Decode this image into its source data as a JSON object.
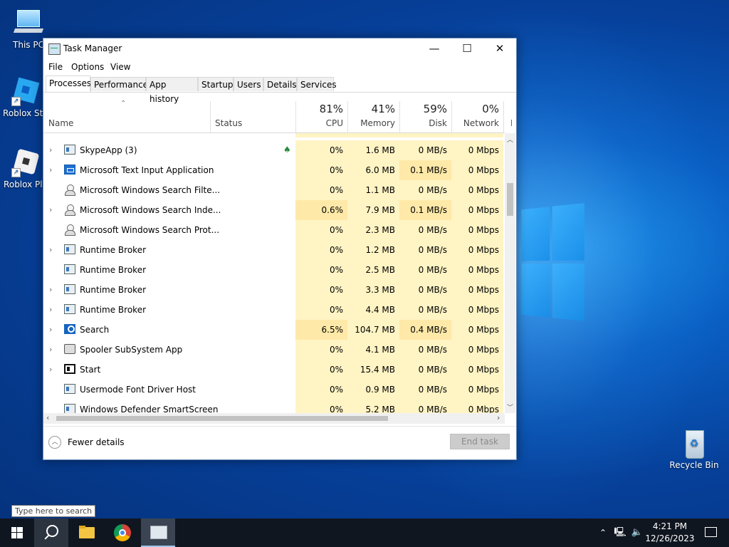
{
  "desktop": {
    "icons": [
      {
        "label": "This PC"
      },
      {
        "label": "Roblox Stu"
      },
      {
        "label": "Roblox Pla"
      },
      {
        "label": "Recycle Bin"
      }
    ]
  },
  "window": {
    "title": "Task Manager",
    "controls": {
      "minimize": "—",
      "maximize": "☐",
      "close": "✕"
    },
    "menu": [
      "File",
      "Options",
      "View"
    ],
    "tabs": [
      "Processes",
      "Performance",
      "App history",
      "Startup",
      "Users",
      "Details",
      "Services"
    ],
    "active_tab": "Processes",
    "columns": {
      "name": "Name",
      "status": "Status",
      "cpu": {
        "percent": "81%",
        "label": "CPU"
      },
      "memory": {
        "percent": "41%",
        "label": "Memory"
      },
      "disk": {
        "percent": "59%",
        "label": "Disk"
      },
      "network": {
        "percent": "0%",
        "label": "Network"
      },
      "power": {
        "label": "P"
      }
    },
    "processes": [
      {
        "name": "SkypeApp (3)",
        "expandable": true,
        "icon": "window-icon",
        "status_icon": "leaf-icon",
        "cpu": "0%",
        "memory": "1.6 MB",
        "disk": "0 MB/s",
        "network": "0 Mbps"
      },
      {
        "name": "Microsoft Text Input Application",
        "expandable": true,
        "icon": "keyboard-icon",
        "cpu": "0%",
        "memory": "6.0 MB",
        "disk": "0.1 MB/s",
        "network": "0 Mbps"
      },
      {
        "name": "Microsoft Windows Search Filte...",
        "expandable": false,
        "icon": "search-user-icon",
        "cpu": "0%",
        "memory": "1.1 MB",
        "disk": "0 MB/s",
        "network": "0 Mbps"
      },
      {
        "name": "Microsoft Windows Search Inde...",
        "expandable": true,
        "icon": "search-user-icon",
        "cpu": "0.6%",
        "memory": "7.9 MB",
        "disk": "0.1 MB/s",
        "network": "0 Mbps"
      },
      {
        "name": "Microsoft Windows Search Prot...",
        "expandable": false,
        "icon": "search-user-icon",
        "cpu": "0%",
        "memory": "2.3 MB",
        "disk": "0 MB/s",
        "network": "0 Mbps"
      },
      {
        "name": "Runtime Broker",
        "expandable": true,
        "icon": "window-icon",
        "cpu": "0%",
        "memory": "1.2 MB",
        "disk": "0 MB/s",
        "network": "0 Mbps"
      },
      {
        "name": "Runtime Broker",
        "expandable": false,
        "icon": "window-icon",
        "cpu": "0%",
        "memory": "2.5 MB",
        "disk": "0 MB/s",
        "network": "0 Mbps"
      },
      {
        "name": "Runtime Broker",
        "expandable": true,
        "icon": "window-icon",
        "cpu": "0%",
        "memory": "3.3 MB",
        "disk": "0 MB/s",
        "network": "0 Mbps"
      },
      {
        "name": "Runtime Broker",
        "expandable": true,
        "icon": "window-icon",
        "cpu": "0%",
        "memory": "4.4 MB",
        "disk": "0 MB/s",
        "network": "0 Mbps"
      },
      {
        "name": "Search",
        "expandable": true,
        "icon": "search-icon",
        "cpu": "6.5%",
        "memory": "104.7 MB",
        "disk": "0.4 MB/s",
        "network": "0 Mbps"
      },
      {
        "name": "Spooler SubSystem App",
        "expandable": true,
        "icon": "printer-icon",
        "cpu": "0%",
        "memory": "4.1 MB",
        "disk": "0 MB/s",
        "network": "0 Mbps"
      },
      {
        "name": "Start",
        "expandable": true,
        "icon": "start-icon",
        "cpu": "0%",
        "memory": "15.4 MB",
        "disk": "0 MB/s",
        "network": "0 Mbps"
      },
      {
        "name": "Usermode Font Driver Host",
        "expandable": false,
        "icon": "window-icon",
        "cpu": "0%",
        "memory": "0.9 MB",
        "disk": "0 MB/s",
        "network": "0 Mbps"
      },
      {
        "name": "Windows Defender SmartScreen",
        "expandable": false,
        "icon": "window-icon",
        "cpu": "0%",
        "memory": "5.2 MB",
        "disk": "0 MB/s",
        "network": "0 Mbps"
      }
    ],
    "footer": {
      "fewer_details": "Fewer details",
      "end_task": "End task"
    }
  },
  "taskbar": {
    "search_tooltip": "Type here to search",
    "time": "4:21 PM",
    "date": "12/26/2023"
  },
  "colors": {
    "heat_light": "#fff4c4",
    "heat_mid": "#ffe9a8",
    "taskbar": "#101620"
  }
}
